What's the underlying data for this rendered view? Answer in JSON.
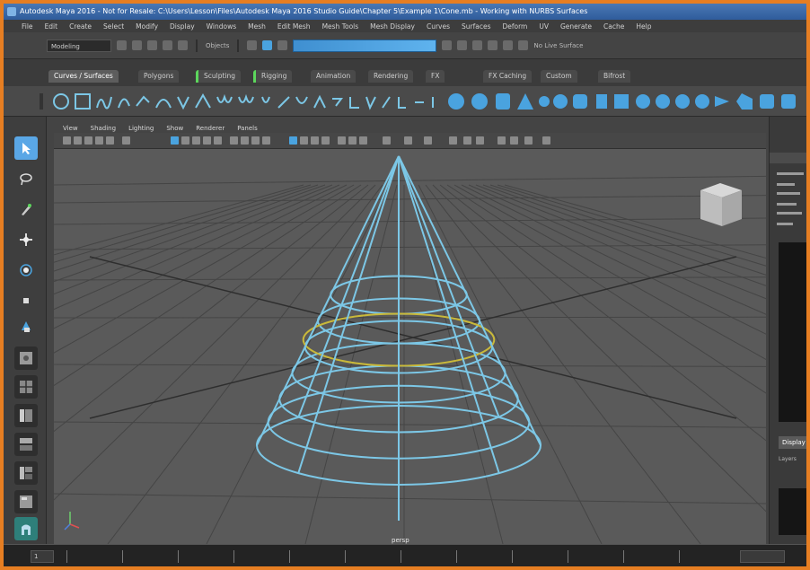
{
  "window": {
    "title": "Autodesk Maya 2016 - Not for Resale: C:\\Users\\Lesson\\Files\\Autodesk Maya 2016 Studio Guide\\Chapter 5\\Example 1\\Cone.mb - Working with NURBS Surfaces"
  },
  "menubar": {
    "items": [
      "File",
      "Edit",
      "Create",
      "Select",
      "Modify",
      "Display",
      "Windows",
      "Mesh",
      "Edit Mesh",
      "Mesh Tools",
      "Mesh Display",
      "Curves",
      "Surfaces",
      "Deform",
      "UV",
      "Generate",
      "Cache",
      "Help"
    ]
  },
  "statusline": {
    "mode": "Modeling",
    "objects_label": "Objects",
    "no_live_surface": "No Live Surface",
    "accent": "#4aa3df"
  },
  "shelf": {
    "tabs": [
      "Curves / Surfaces",
      "Polygons",
      "Sculpting",
      "Rigging",
      "Animation",
      "Rendering",
      "FX",
      "FX Caching",
      "Custom",
      "Bifrost"
    ],
    "active_index": 0
  },
  "panel": {
    "menus": [
      "View",
      "Shading",
      "Lighting",
      "Show",
      "Renderer",
      "Panels"
    ],
    "camera_label": "persp"
  },
  "right_panel": {
    "tab_label": "Display",
    "sub_label": "Layers"
  },
  "timeline": {
    "ticks": [
      "1",
      "",
      "",
      "",
      "",
      "",
      "",
      "",
      "",
      "",
      "",
      ""
    ],
    "start_field": "1"
  },
  "colors": {
    "curve": "#7cc7e6",
    "selected_isoparm": "#c9b93a",
    "viewport_bg": "#5a5a5a",
    "grid": "#454545",
    "window_border": "#e67e22"
  }
}
